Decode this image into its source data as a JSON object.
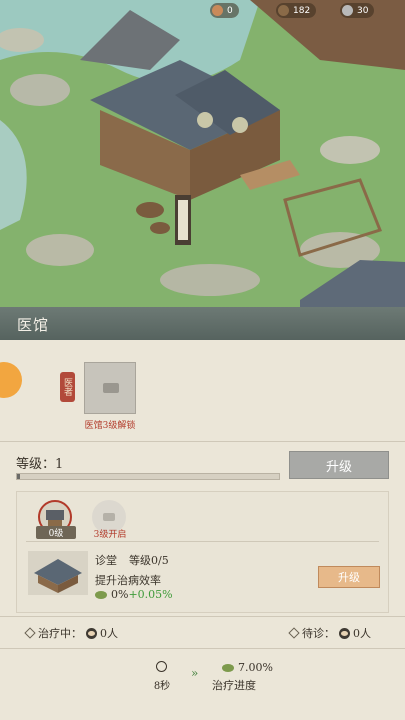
{
  "hud": {
    "jade": "0",
    "wood": "182",
    "silver": "30"
  },
  "title": "医馆",
  "doctor_tag": "医者",
  "unlock_text": "医馆3级解锁",
  "level_label": "等级：1",
  "level_progress": 0.01,
  "upgrade_main": "升级",
  "hall": {
    "level": "0级"
  },
  "hall2": {
    "text": "3级开启"
  },
  "room": {
    "name": "诊堂",
    "level": "等级0/5",
    "desc": "提升治病效率",
    "effect_base": "0%",
    "effect_bonus": "+0.05%"
  },
  "upgrade_small": "升级",
  "treating": {
    "label": "治疗中：",
    "count": "0人"
  },
  "waiting": {
    "label": "待诊：",
    "count": "0人"
  },
  "timer": "8秒",
  "progress": {
    "value": "7.00%",
    "label": "治疗进度"
  },
  "colors": {
    "title_bar": "#5e6b67",
    "accent_red": "#b23a2a",
    "panel": "#ebe6d8",
    "green": "#3f9b3a"
  }
}
